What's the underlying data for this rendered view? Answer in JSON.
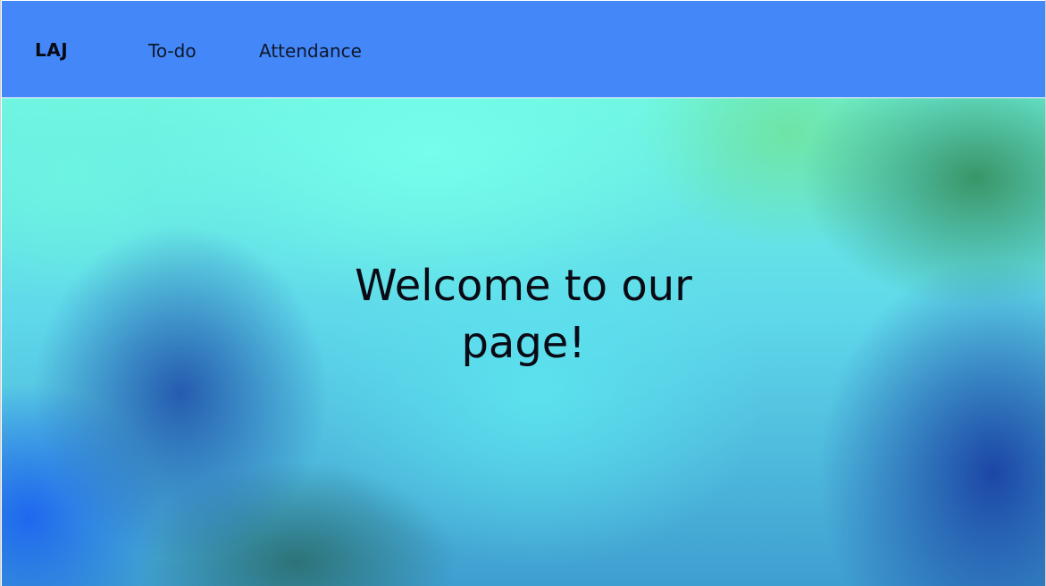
{
  "navbar": {
    "brand": "LAJ",
    "links": [
      {
        "label": "To-do"
      },
      {
        "label": "Attendance"
      }
    ],
    "background_color": "#4387f8"
  },
  "hero": {
    "title": "Welcome to our page!"
  }
}
